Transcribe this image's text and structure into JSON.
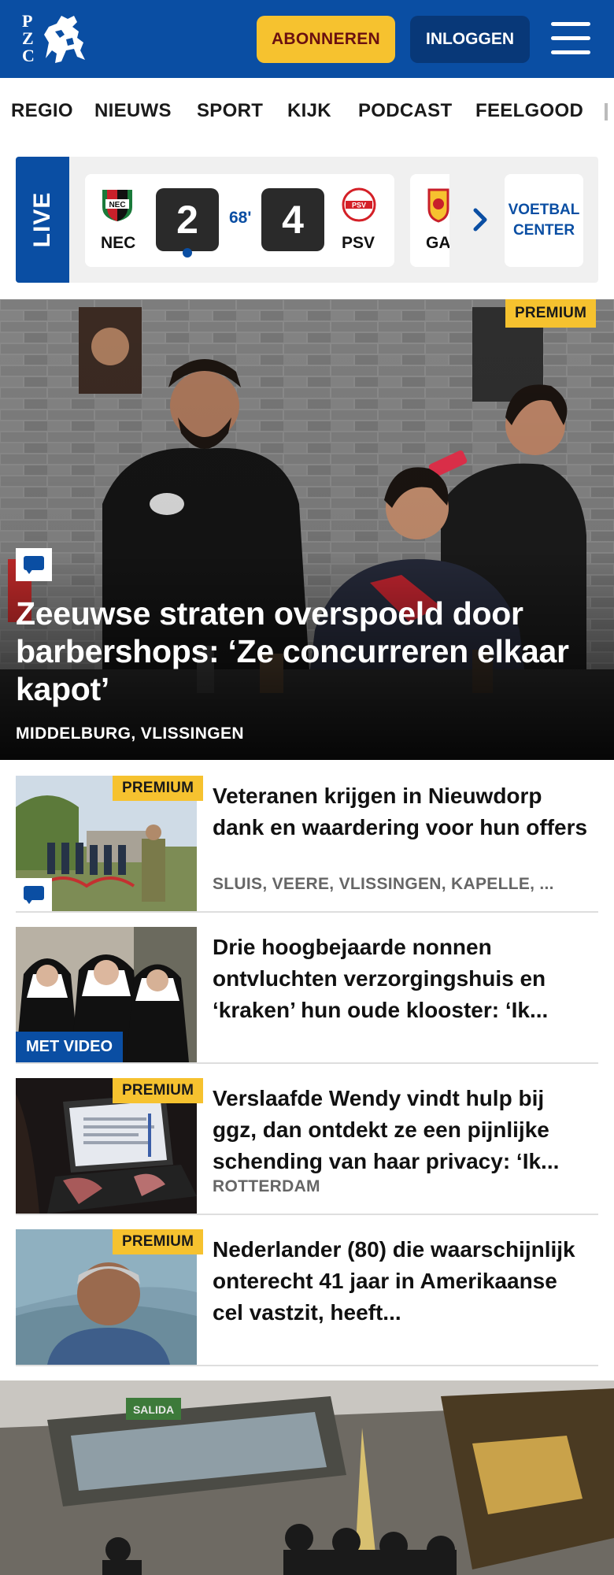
{
  "header": {
    "logo_letters": [
      "P",
      "Z",
      "C"
    ],
    "subscribe_label": "ABONNEREN",
    "login_label": "INLOGGEN"
  },
  "nav": {
    "items": [
      "REGIO",
      "NIEUWS",
      "SPORT",
      "KIJK",
      "PODCAST",
      "FEELGOOD"
    ]
  },
  "live": {
    "label": "LIVE",
    "match": {
      "home": "NEC",
      "away": "PSV",
      "home_score": "2",
      "away_score": "4",
      "minute": "68'"
    },
    "next_team_partial": "GA",
    "voetbal_center": [
      "VOETBAL",
      "CENTER"
    ]
  },
  "hero": {
    "premium_label": "PREMIUM",
    "title": "Zeeuwse straten overspoeld door barbershops: ‘Ze concurreren elkaar kapot’",
    "location": "MIDDELBURG, VLISSINGEN"
  },
  "articles": [
    {
      "title": "Veteranen krijgen in Nieuwdorp dank en waardering voor hun offers",
      "location": "SLUIS, VEERE, VLISSINGEN, KAPELLE, ...",
      "tag": "PREMIUM"
    },
    {
      "title": "Drie hoogbejaarde nonnen ontvluchten verzorgingshuis en ‘kraken’ hun oude klooster: ‘Ik...",
      "location": "",
      "tag": "MET VIDEO"
    },
    {
      "title": "Verslaafde Wendy vindt hulp bij ggz, dan ontdekt ze een pijnlijke schending van haar privacy: ‘Ik...",
      "location": "ROTTERDAM",
      "tag": "PREMIUM"
    },
    {
      "title": "Nederlander (80) die waarschijn­lijk onterecht 41 jaar in Amerikaanse cel vastzit, heeft...",
      "location": "",
      "tag": "PREMIUM"
    }
  ],
  "bottom_image": {
    "sign_text": "SALIDA"
  },
  "colors": {
    "brand_blue": "#0a4ea3",
    "premium_yellow": "#f6c22f",
    "subscribe_text": "#6a1010"
  }
}
